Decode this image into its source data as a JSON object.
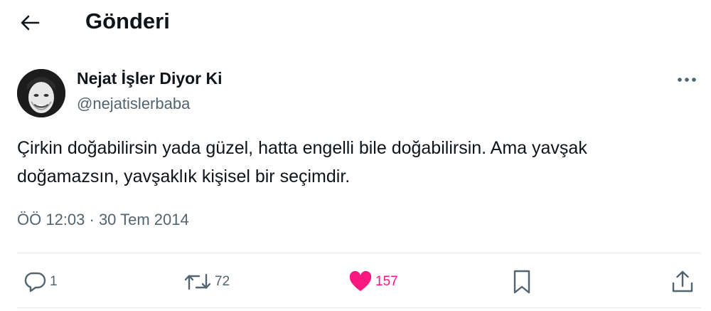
{
  "header": {
    "title": "Gönderi",
    "back_icon": "arrow-left-icon"
  },
  "post": {
    "author_name": "Nejat İşler Diyor Ki",
    "author_handle": "@nejatislerbaba",
    "text_lines": [
      "Çirkin doğabilirsin yada güzel, hatta engelli bile doğabilirsin. Ama yavşak",
      "doğamazsın, yavşaklık kişisel bir seçimdir."
    ],
    "timestamp": "ÖÖ 12:03 · 30 Tem 2014"
  },
  "actions": {
    "replies": "1",
    "reposts": "72",
    "likes": "157",
    "liked": true,
    "like_color": "#f91880",
    "muted_color": "#536471"
  }
}
